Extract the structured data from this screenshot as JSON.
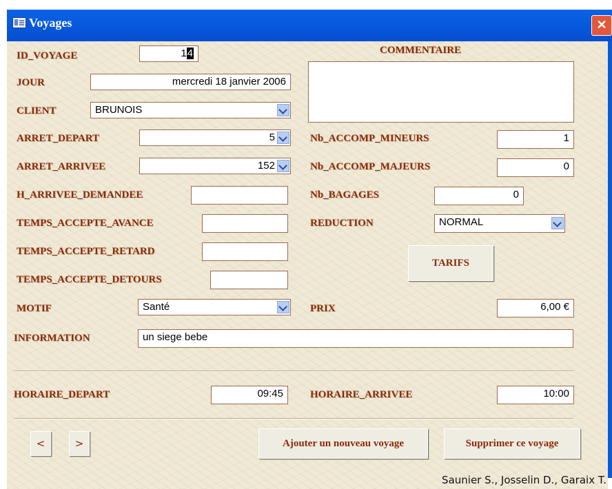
{
  "window": {
    "title": "Voyages",
    "close_glyph": "✕"
  },
  "labels": {
    "id_voyage": "ID_VOYAGE",
    "jour": "JOUR",
    "client": "CLIENT",
    "arret_depart": "ARRET_DEPART",
    "arret_arrivee": "ARRET_ARRIVEE",
    "h_arrivee_demandee": "H_ARRIVEE_DEMANDEE",
    "temps_accepte_avance": "TEMPS_ACCEPTE_AVANCE",
    "temps_accepte_retard": "TEMPS_ACCEPTE_RETARD",
    "temps_accepte_detours": "TEMPS_ACCEPTE_DETOURS",
    "motif": "MOTIF",
    "information": "INFORMATION",
    "commentaire": "COMMENTAIRE",
    "nb_accomp_mineurs": "Nb_ACCOMP_MINEURS",
    "nb_accomp_majeurs": "Nb_ACCOMP_MAJEURS",
    "nb_bagages": "Nb_BAGAGES",
    "reduction": "REDUCTION",
    "prix": "PRIX",
    "horaire_depart": "HORAIRE_DEPART",
    "horaire_arrivee": "HORAIRE_ARRIVEE"
  },
  "values": {
    "id_voyage_prefix": "1",
    "id_voyage_selected": "4",
    "jour": "mercredi 18 janvier 2006",
    "client": "BRUNOIS",
    "arret_depart": "5",
    "arret_arrivee": "152",
    "h_arrivee_demandee": "",
    "temps_accepte_avance": "",
    "temps_accepte_retard": "",
    "temps_accepte_detours": "",
    "motif": "Santé",
    "information": "un siege bebe",
    "commentaire": "",
    "nb_accomp_mineurs": "1",
    "nb_accomp_majeurs": "0",
    "nb_bagages": "0",
    "reduction": "NORMAL",
    "prix": "6,00 €",
    "horaire_depart": "09:45",
    "horaire_arrivee": "10:00"
  },
  "buttons": {
    "tarifs": "TARIFS",
    "prev": "<",
    "next": ">",
    "ajouter": "Ajouter un nouveau voyage",
    "supprimer": "Supprimer ce voyage"
  },
  "footer": {
    "credit": "Saunier S., Josselin D., Garaix T."
  },
  "icons": {
    "window_icon": "form-icon",
    "dropdown": "chevron-down-icon"
  },
  "colors": {
    "label": "#8c2a0b",
    "titlebar": "#0a5ad6",
    "background": "#efe9d6"
  }
}
